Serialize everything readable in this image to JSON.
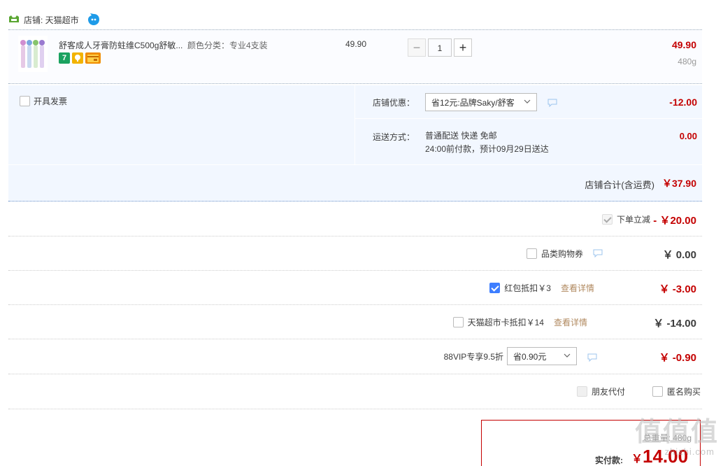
{
  "shop": {
    "label": "店铺: 天猫超市"
  },
  "item": {
    "title": "舒客成人牙膏防蛀维C500g舒敏...",
    "sku": "颜色分类：专业4支装",
    "unit_price": "49.90",
    "quantity": "1",
    "minus": "−",
    "plus": "+",
    "subtotal": "49.90",
    "weight": "480g",
    "badges": [
      "7",
      "",
      ""
    ]
  },
  "invoice": {
    "label": "开具发票"
  },
  "shop_discount": {
    "label": "店铺优惠：",
    "selected": "省12元:品牌Saky/舒客",
    "value": "-12.00"
  },
  "shipping": {
    "label": "运送方式：",
    "line1": "普通配送 快递 免邮",
    "line2": "24:00前付款，预计09月29日送达",
    "value": "0.00"
  },
  "shop_total": {
    "label": "店铺合计(含运费)",
    "value": "￥37.90"
  },
  "discounts": {
    "instant": {
      "label": "下单立减",
      "value": "- ￥20.00"
    },
    "category_coupon": {
      "label": "品类购物券",
      "value": "￥ 0.00"
    },
    "red_packet": {
      "label": "红包抵扣￥3",
      "link": "查看详情",
      "value": "￥ -3.00"
    },
    "tmall_card": {
      "label": "天猫超市卡抵扣￥14",
      "link": "查看详情",
      "value": "￥ -14.00"
    },
    "vip": {
      "label": "88VIP专享9.5折",
      "selected": "省0.90元",
      "value": "￥ -0.90"
    }
  },
  "options": {
    "friend_pay": "朋友代付",
    "anonymous": "匿名购买"
  },
  "pay": {
    "weight": "总重量: 480g",
    "label": "实付款:",
    "yen": "￥",
    "amount": "14.00"
  },
  "watermark": {
    "chars": "值值值",
    "url": "zhizhi.com"
  },
  "colors": {
    "accent_red": "#c40000",
    "tint_blue": "#f2f7ff",
    "checkbox_blue": "#3d7eff",
    "link_brown": "#b18a60"
  }
}
